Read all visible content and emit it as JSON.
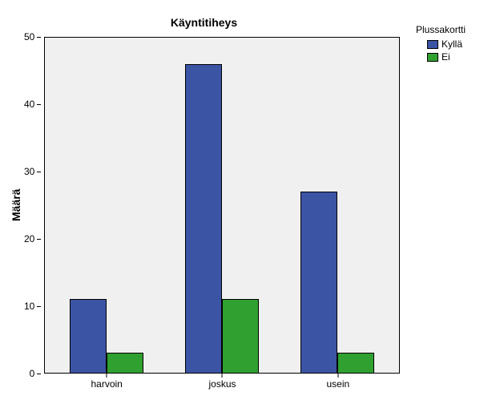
{
  "chart_data": {
    "type": "bar",
    "title": "Käyntitiheys",
    "ylabel": "Määrä",
    "xlabel": "",
    "ylim": [
      0,
      50
    ],
    "yticks": [
      0,
      10,
      20,
      30,
      40,
      50
    ],
    "categories": [
      "harvoin",
      "joskus",
      "usein"
    ],
    "legend_title": "Plussakortti",
    "series": [
      {
        "name": "Kyllä",
        "values": [
          11,
          46,
          27
        ]
      },
      {
        "name": "Ei",
        "values": [
          3,
          11,
          3
        ]
      }
    ]
  }
}
